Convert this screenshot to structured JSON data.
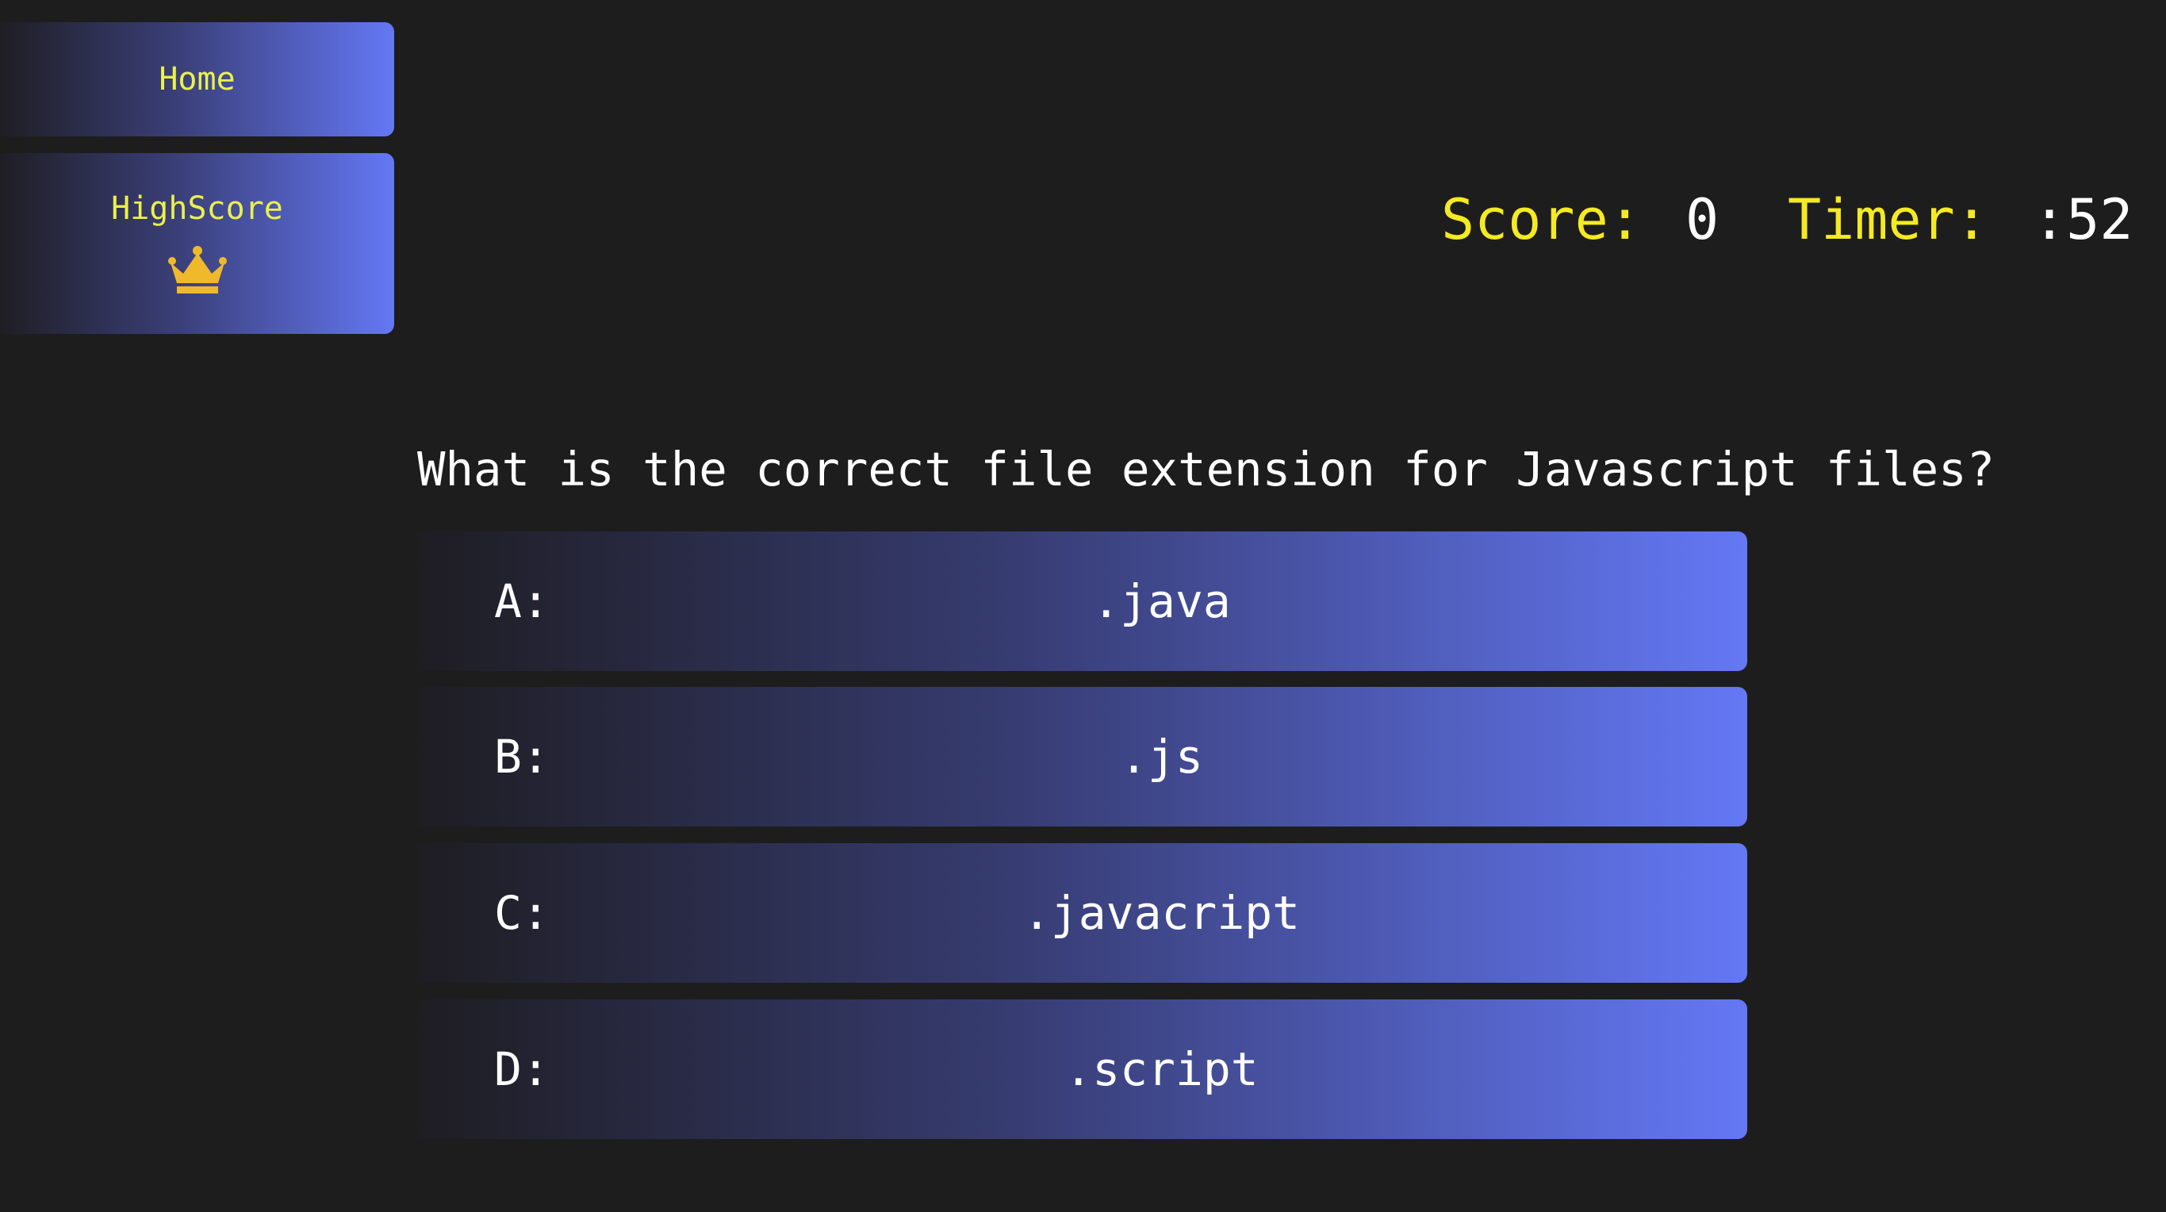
{
  "nav": {
    "home_label": "Home",
    "highscore_label": "HighScore",
    "highscore_icon": "crown-icon",
    "accent_color": "#eaf14a"
  },
  "stats": {
    "score_label": "Score:",
    "score_value": "0",
    "timer_label": "Timer:",
    "timer_value": ":52"
  },
  "quiz": {
    "question": "What is the correct file extension for Javascript files?",
    "answers": [
      {
        "letter": "A:",
        "text": ".java"
      },
      {
        "letter": "B:",
        "text": ".js"
      },
      {
        "letter": "C:",
        "text": ".javacript"
      },
      {
        "letter": "D:",
        "text": ".script"
      }
    ]
  },
  "colors": {
    "background": "#1e1d1d",
    "gradient_end": "#6478f5",
    "stat_label": "#f4ea23"
  }
}
